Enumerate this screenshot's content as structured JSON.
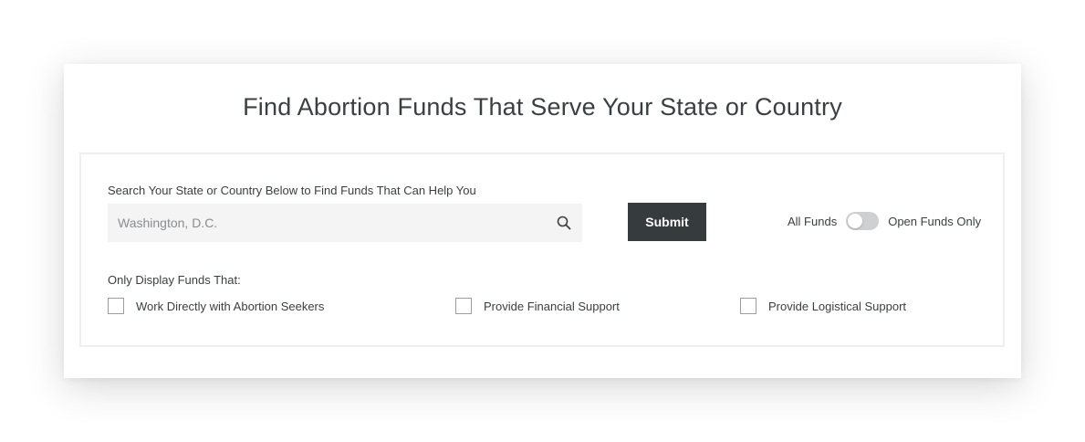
{
  "page": {
    "title": "Find Abortion Funds That Serve Your State or Country"
  },
  "search": {
    "label": "Search Your State or Country Below to Find Funds That Can Help You",
    "placeholder": "Washington, D.C.",
    "value": "",
    "icon": "search-icon"
  },
  "submit": {
    "label": "Submit"
  },
  "fund_toggle": {
    "left_label": "All Funds",
    "right_label": "Open Funds Only",
    "selected": "All Funds"
  },
  "filters": {
    "label": "Only Display Funds That:",
    "options": [
      {
        "label": "Work Directly with Abortion Seekers",
        "checked": false
      },
      {
        "label": "Provide Financial Support",
        "checked": false
      },
      {
        "label": "Provide Logistical Support",
        "checked": false
      }
    ]
  },
  "colors": {
    "button_bg": "#363c3e",
    "input_bg": "#f4f4f4",
    "text": "#3a3f41",
    "toggle_track": "#cfd0d1"
  }
}
